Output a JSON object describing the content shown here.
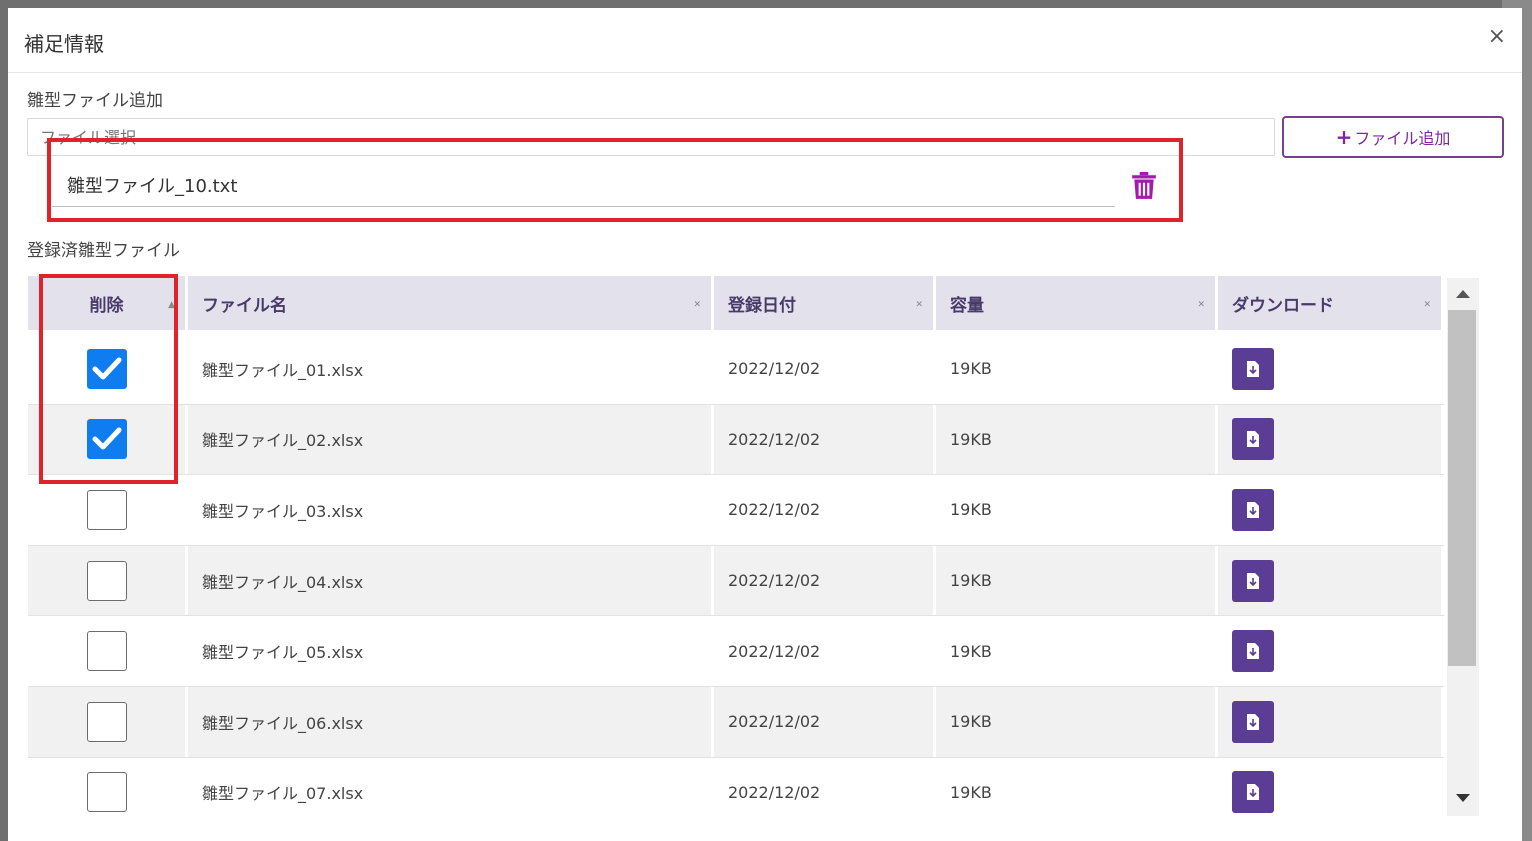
{
  "dialog": {
    "title": "補足情報",
    "close": "×"
  },
  "upload": {
    "label": "雛型ファイル追加",
    "placeholder": "ファイル選択",
    "add_button_plus": "+",
    "add_button_label": "ファイル追加",
    "selected_file": "雛型ファイル_10.txt"
  },
  "registered": {
    "label": "登録済雛型ファイル",
    "columns": [
      "削除",
      "ファイル名",
      "登録日付",
      "容量",
      "ダウンロード"
    ],
    "rows": [
      {
        "checked": true,
        "name": "雛型ファイル_01.xlsx",
        "date": "2022/12/02",
        "size": "19KB"
      },
      {
        "checked": true,
        "name": "雛型ファイル_02.xlsx",
        "date": "2022/12/02",
        "size": "19KB"
      },
      {
        "checked": false,
        "name": "雛型ファイル_03.xlsx",
        "date": "2022/12/02",
        "size": "19KB"
      },
      {
        "checked": false,
        "name": "雛型ファイル_04.xlsx",
        "date": "2022/12/02",
        "size": "19KB"
      },
      {
        "checked": false,
        "name": "雛型ファイル_05.xlsx",
        "date": "2022/12/02",
        "size": "19KB"
      },
      {
        "checked": false,
        "name": "雛型ファイル_06.xlsx",
        "date": "2022/12/02",
        "size": "19KB"
      },
      {
        "checked": false,
        "name": "雛型ファイル_07.xlsx",
        "date": "2022/12/02",
        "size": "19KB"
      }
    ]
  },
  "colors": {
    "accent": "#7a2a9c",
    "download": "#5b3d96",
    "checkbox": "#0f7cf0",
    "highlight": "#e0232b",
    "header_bg": "#e3e1ec"
  }
}
